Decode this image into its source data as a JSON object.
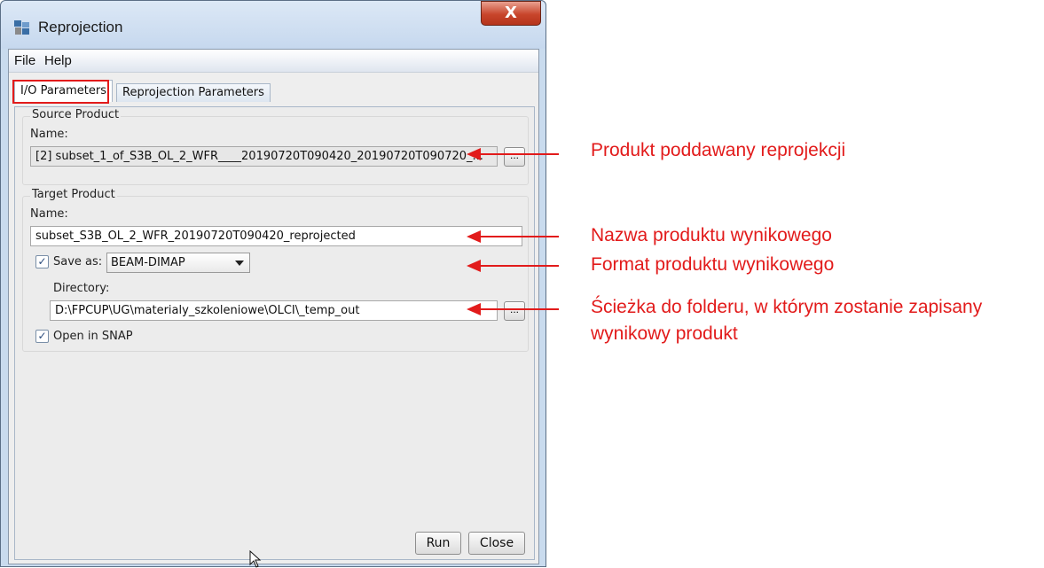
{
  "window": {
    "title": "Reprojection",
    "close_glyph": "X"
  },
  "menu": {
    "items": [
      "File",
      "Help"
    ]
  },
  "tabs": [
    {
      "label": "I/O Parameters",
      "active": true
    },
    {
      "label": "Reprojection Parameters",
      "active": false
    }
  ],
  "source_product": {
    "group_title": "Source Product",
    "name_label": "Name:",
    "name_value": "[2] subset_1_of_S3B_OL_2_WFR____20190720T090420_20190720T090720_...",
    "browse_label": "..."
  },
  "target_product": {
    "group_title": "Target Product",
    "name_label": "Name:",
    "name_value": "subset_S3B_OL_2_WFR_20190720T090420_reprojected",
    "save_as_label": "Save as:",
    "save_as_checked": true,
    "format_value": "BEAM-DIMAP",
    "directory_label": "Directory:",
    "directory_value": "D:\\FPCUP\\UG\\materialy_szkoleniowe\\OLCI\\_temp_out",
    "browse_label": "...",
    "open_in_snap_label": "Open in SNAP",
    "open_in_snap_checked": true
  },
  "buttons": {
    "run": "Run",
    "close": "Close"
  },
  "annotations": {
    "source": "Produkt poddawany reprojekcji",
    "name": "Nazwa produktu wynikowego",
    "format": "Format produktu wynikowego",
    "directory_line1": "Ścieżka do folderu, w którym zostanie zapisany",
    "directory_line2": "wynikowy produkt"
  },
  "colors": {
    "annotation": "#e21b1b",
    "checkmark": "#2b4b7c"
  }
}
